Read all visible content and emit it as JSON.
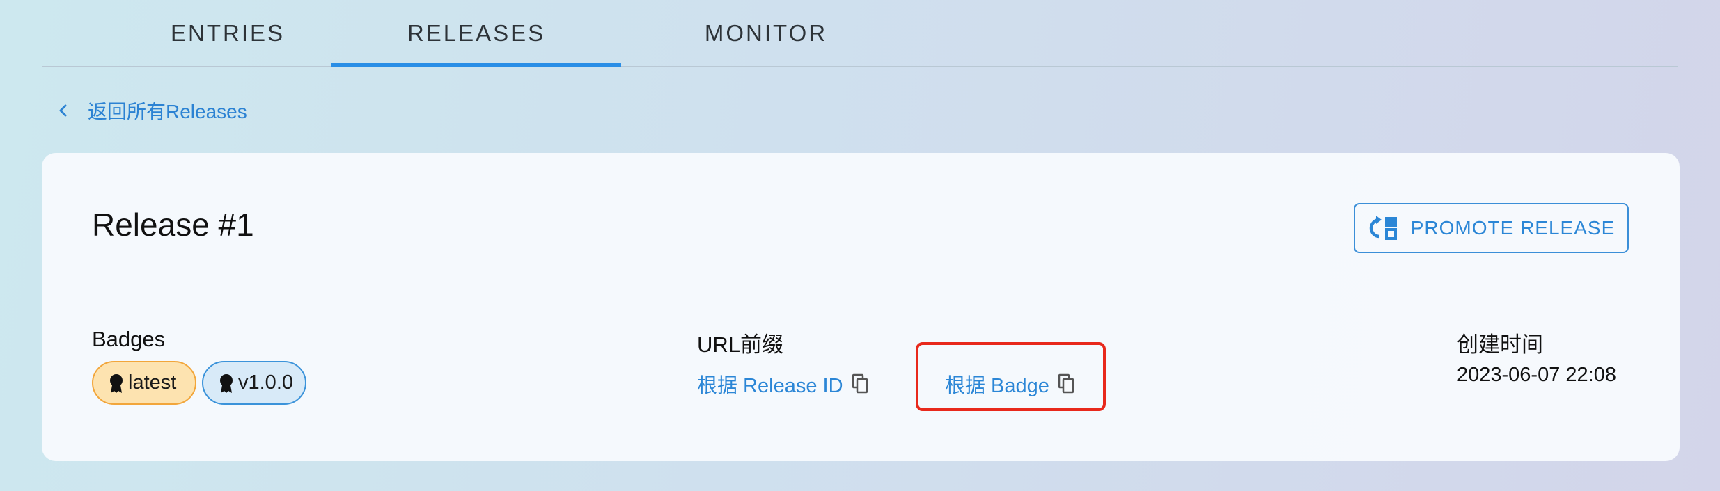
{
  "tabs": [
    {
      "label": "ENTRIES"
    },
    {
      "label": "RELEASES",
      "active": true
    },
    {
      "label": "MONITOR"
    }
  ],
  "back_link": {
    "label": "返回所有Releases"
  },
  "release": {
    "title": "Release #1",
    "promote_label": "PROMOTE RELEASE",
    "badges_label": "Badges",
    "badges": [
      {
        "label": "latest",
        "color": "#fde3b0"
      },
      {
        "label": "v1.0.0",
        "color": "#d8eaf8"
      }
    ],
    "url_prefix_label": "URL前缀",
    "url_links": [
      {
        "label": "根据 Release ID"
      },
      {
        "label": "根据 Badge"
      }
    ],
    "created_label": "创建时间",
    "created_value": "2023-06-07 22:08"
  },
  "colors": {
    "accent": "#2b86d6",
    "highlight": "#e8291c"
  }
}
